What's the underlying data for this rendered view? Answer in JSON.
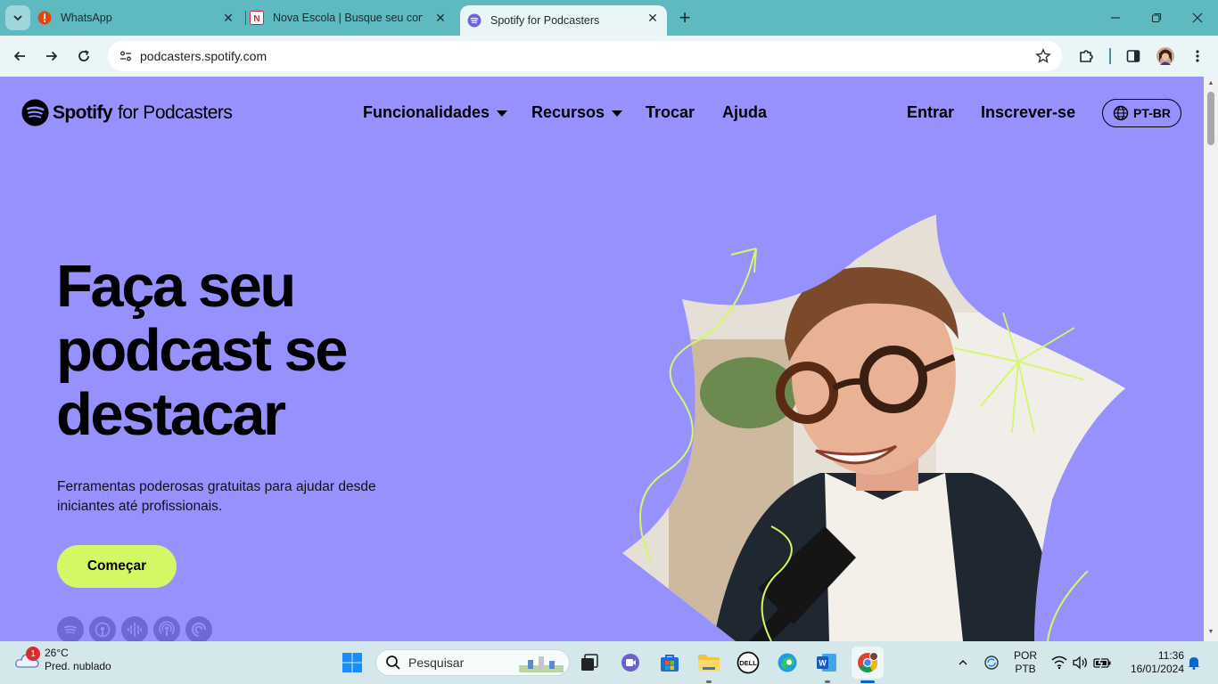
{
  "browser": {
    "tabs": [
      {
        "title": "WhatsApp",
        "favicon": "whatsapp-alert-icon",
        "active": false
      },
      {
        "title": "Nova Escola | Busque seu conte",
        "favicon": "nova-escola-icon",
        "active": false
      },
      {
        "title": "Spotify for Podcasters",
        "favicon": "spotify-icon",
        "active": true
      }
    ],
    "url": "podcasters.spotify.com"
  },
  "site": {
    "brand": "Spotify",
    "brand_sub": "for Podcasters",
    "nav": {
      "features": "Funcionalidades",
      "resources": "Recursos",
      "switch": "Trocar",
      "help": "Ajuda"
    },
    "login": "Entrar",
    "signup": "Inscrever-se",
    "language": "PT-BR"
  },
  "hero": {
    "title_lines": [
      "Faça seu",
      "podcast se",
      "destacar"
    ],
    "subtitle": "Ferramentas poderosas gratuitas para ajudar desde iniciantes até profissionais.",
    "cta": "Começar",
    "platform_icons": [
      "spotify-icon",
      "apple-podcasts-icon",
      "google-podcasts-icon",
      "podcast-icon",
      "pocket-casts-icon"
    ]
  },
  "taskbar": {
    "weather_temp": "26°C",
    "weather_desc": "Pred. nublado",
    "notification_count": "1",
    "search_placeholder": "Pesquisar",
    "lang_line1": "POR",
    "lang_line2": "PTB",
    "time": "11:36",
    "date": "16/01/2024"
  },
  "colors": {
    "page_bg": "#9691ff",
    "cta_bg": "#d2f965",
    "tabstrip_bg": "#5fb9c1",
    "toolbar_bg": "#e9f5f6"
  }
}
